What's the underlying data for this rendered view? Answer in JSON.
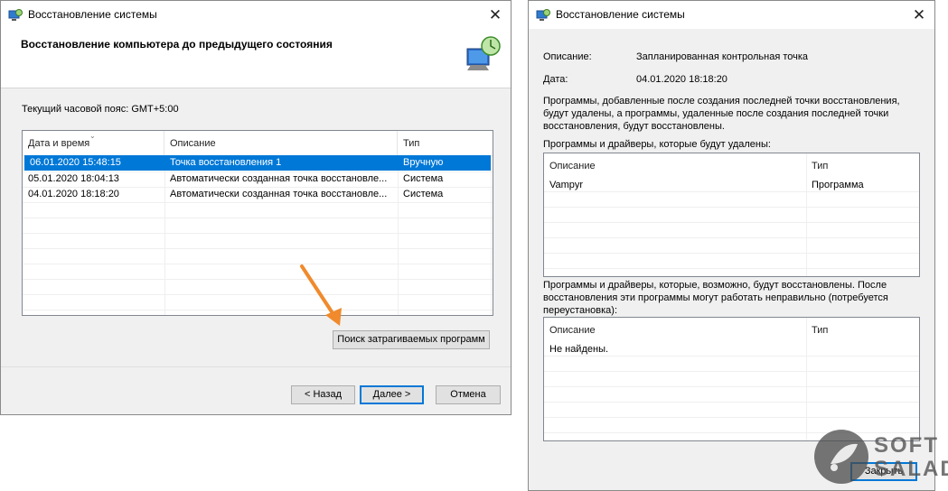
{
  "left_window": {
    "title": "Восстановление системы",
    "close_glyph": "✕",
    "header_title": "Восстановление компьютера до предыдущего состояния",
    "timezone": "Текущий часовой пояс: GMT+5:00",
    "columns": [
      "Дата и время",
      "Описание",
      "Тип"
    ],
    "rows": [
      {
        "date": "06.01.2020 15:48:15",
        "desc": "Точка восстановления 1",
        "type": "Вручную",
        "selected": true
      },
      {
        "date": "05.01.2020 18:04:13",
        "desc": "Автоматически созданная точка восстановле...",
        "type": "Система",
        "selected": false
      },
      {
        "date": "04.01.2020 18:18:20",
        "desc": "Автоматически созданная точка восстановле...",
        "type": "Система",
        "selected": false
      }
    ],
    "scan_button": "Поиск затрагиваемых программ",
    "back_button": "< Назад",
    "next_button": "Далее >",
    "cancel_button": "Отмена",
    "selection_color": "#0078d7",
    "arrow_color": "#f08a2c"
  },
  "right_window": {
    "title": "Восстановление системы",
    "close_glyph": "✕",
    "description_label": "Описание:",
    "description_value": "Запланированная контрольная точка",
    "date_label": "Дата:",
    "date_value": "04.01.2020 18:18:20",
    "info_line1": "Программы, добавленные после создания последней точки восстановления,",
    "info_line2": "будут удалены, а программы, удаленные после создания последней точки",
    "info_line3": "восстановления, будут восстановлены.",
    "deleted_heading": "Программы и драйверы, которые будут удалены:",
    "columns": [
      "Описание",
      "Тип"
    ],
    "deleted_rows": [
      {
        "desc": "Vampyr",
        "type": "Программа"
      }
    ],
    "restored_line1": "Программы и драйверы, которые, возможно, будут восстановлены. После",
    "restored_line2": "восстановления эти программы могут работать неправильно (потребуется",
    "restored_line3": "переустановка):",
    "restored_rows": [
      {
        "desc": "Не найдены.",
        "type": ""
      }
    ],
    "close_button": "Закрыть"
  },
  "watermark": {
    "line1": "SOFT",
    "line2": "SALAD"
  }
}
